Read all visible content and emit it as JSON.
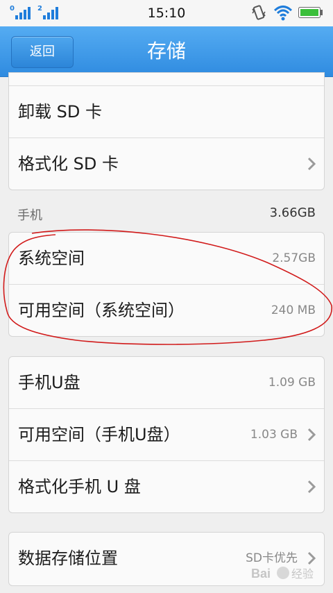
{
  "status_bar": {
    "sim1_label": "0",
    "sim2_label": "2",
    "time": "15:10",
    "icons": [
      "signal-icon",
      "vibrate-icon",
      "wifi-icon",
      "battery-icon"
    ]
  },
  "header": {
    "back_label": "返回",
    "title": "存储"
  },
  "sd_card": {
    "rows": [
      {
        "label": "卸载 SD 卡"
      },
      {
        "label": "格式化 SD 卡"
      }
    ]
  },
  "phone_section": {
    "label": "手机",
    "total": "3.66GB"
  },
  "phone_card": {
    "rows": [
      {
        "label": "系统空间",
        "value": "2.57GB"
      },
      {
        "label": "可用空间（系统空间）",
        "value": "240 MB"
      }
    ]
  },
  "udisk_card": {
    "rows": [
      {
        "label": "手机U盘",
        "value": "1.09 GB"
      },
      {
        "label": "可用空间（手机U盘）",
        "value": "1.03 GB"
      },
      {
        "label": "格式化手机 U 盘"
      }
    ]
  },
  "data_location_card": {
    "rows": [
      {
        "label": "数据存储位置",
        "value": "SD卡优先"
      }
    ]
  },
  "watermark": {
    "text": "Bai 经验",
    "color": "#c0392b"
  },
  "colors": {
    "header": "#3b95e6",
    "annotation": "#d11a1a",
    "background": "#efefef"
  }
}
